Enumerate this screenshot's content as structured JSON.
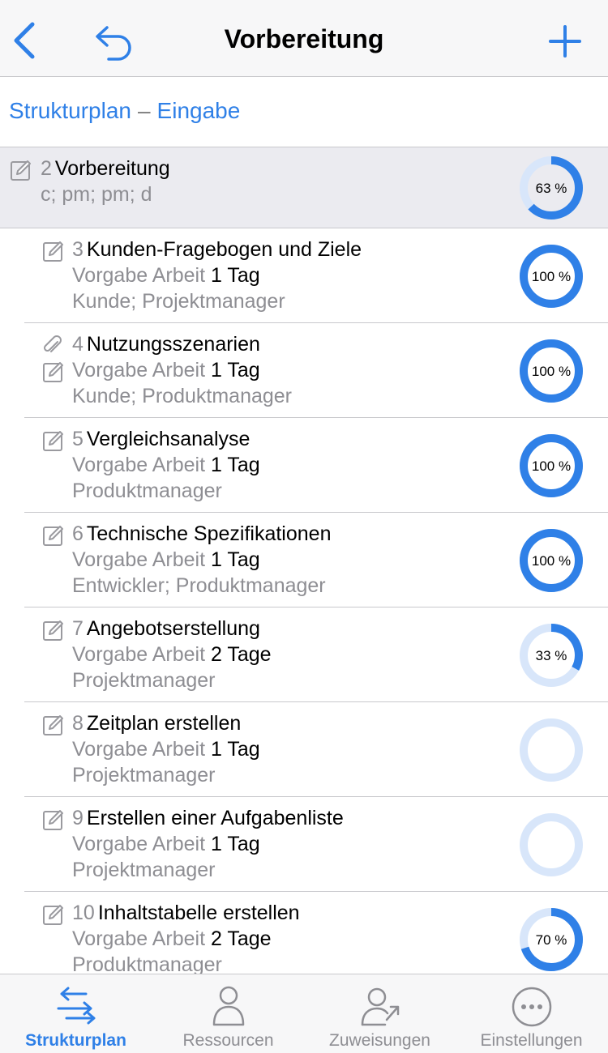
{
  "navbar": {
    "title": "Vorbereitung"
  },
  "breadcrumb": {
    "part1": "Strukturplan",
    "separator": "–",
    "part2": "Eingabe"
  },
  "colors": {
    "accent": "#2f80e7",
    "ring_track": "#d8e6fa",
    "secondary_text": "#8e8e93"
  },
  "parent_task": {
    "number": "2",
    "name": "Vorbereitung",
    "resources": "c; pm; pm; d",
    "progress": 63,
    "progress_label": "63 %",
    "icons": [
      "edit-icon"
    ]
  },
  "tasks": [
    {
      "number": "3",
      "name": "Kunden-Fragebogen und Ziele",
      "work_label": "Vorgabe Arbeit",
      "work_value": "1 Tag",
      "resources": "Kunde; Projektmanager",
      "progress": 100,
      "progress_label": "100 %",
      "icons": [
        "edit-icon"
      ]
    },
    {
      "number": "4",
      "name": "Nutzungsszenarien",
      "work_label": "Vorgabe Arbeit",
      "work_value": "1 Tag",
      "resources": "Kunde; Produktmanager",
      "progress": 100,
      "progress_label": "100 %",
      "icons": [
        "paperclip-icon",
        "edit-icon"
      ]
    },
    {
      "number": "5",
      "name": "Vergleichsanalyse",
      "work_label": "Vorgabe Arbeit",
      "work_value": "1 Tag",
      "resources": "Produktmanager",
      "progress": 100,
      "progress_label": "100 %",
      "icons": [
        "edit-icon"
      ]
    },
    {
      "number": "6",
      "name": "Technische Spezifikationen",
      "work_label": "Vorgabe Arbeit",
      "work_value": "1 Tag",
      "resources": "Entwickler; Produktmanager",
      "progress": 100,
      "progress_label": "100 %",
      "icons": [
        "edit-icon"
      ]
    },
    {
      "number": "7",
      "name": "Angebotserstellung",
      "work_label": "Vorgabe Arbeit",
      "work_value": "2 Tage",
      "resources": "Projektmanager",
      "progress": 33,
      "progress_label": "33 %",
      "icons": [
        "edit-icon"
      ]
    },
    {
      "number": "8",
      "name": "Zeitplan erstellen",
      "work_label": "Vorgabe Arbeit",
      "work_value": "1 Tag",
      "resources": "Projektmanager",
      "progress": 0,
      "progress_label": "",
      "icons": [
        "edit-icon"
      ]
    },
    {
      "number": "9",
      "name": "Erstellen einer Aufgabenliste",
      "work_label": "Vorgabe Arbeit",
      "work_value": "1 Tag",
      "resources": "Projektmanager",
      "progress": 0,
      "progress_label": "",
      "icons": [
        "edit-icon"
      ]
    },
    {
      "number": "10",
      "name": "Inhaltstabelle erstellen",
      "work_label": "Vorgabe Arbeit",
      "work_value": "2 Tage",
      "resources": "Produktmanager",
      "progress": 70,
      "progress_label": "70 %",
      "icons": [
        "edit-icon"
      ]
    }
  ],
  "tabbar": {
    "tabs": [
      {
        "label": "Strukturplan",
        "icon": "structure-arrows-icon",
        "active": true
      },
      {
        "label": "Ressourcen",
        "icon": "person-icon",
        "active": false
      },
      {
        "label": "Zuweisungen",
        "icon": "person-assign-icon",
        "active": false
      },
      {
        "label": "Einstellungen",
        "icon": "more-icon",
        "active": false
      }
    ]
  }
}
